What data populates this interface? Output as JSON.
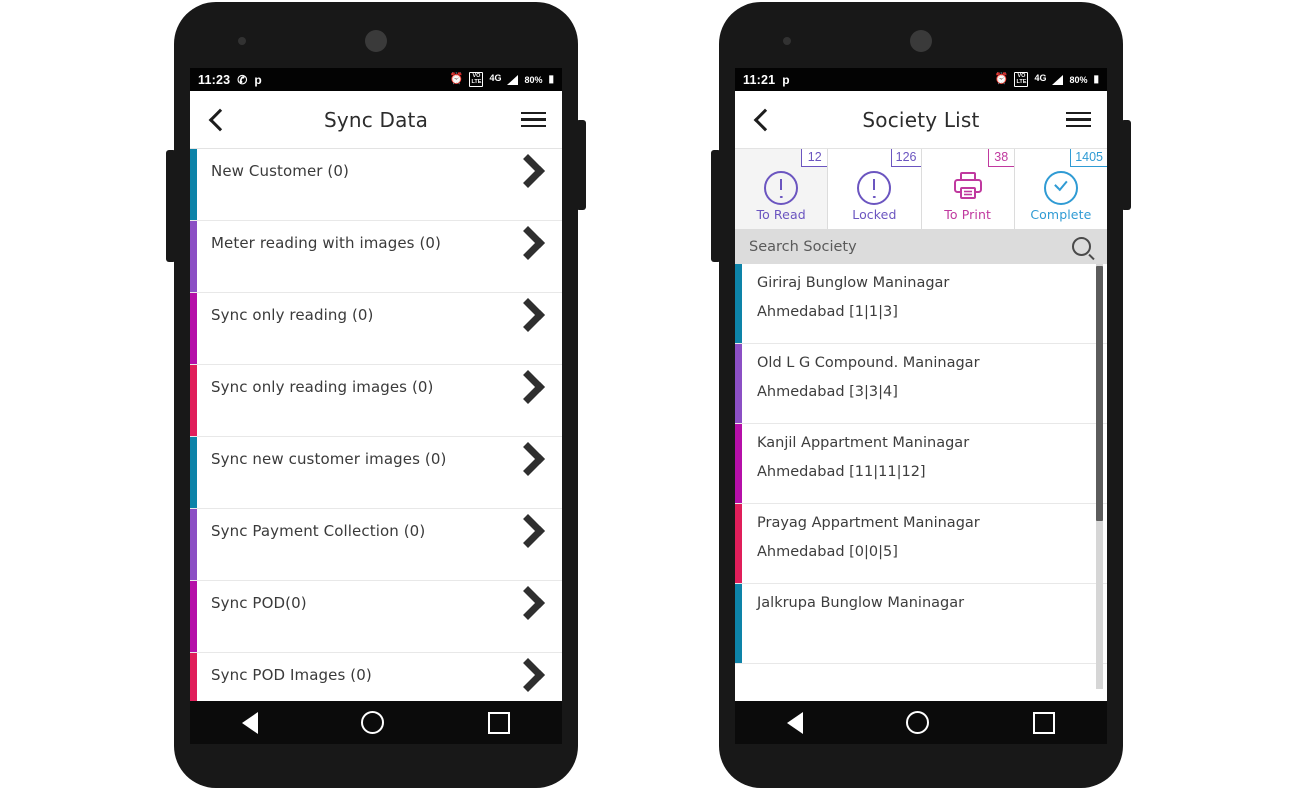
{
  "colors": {
    "teal": "#0d83a8",
    "purple": "#8b4fc4",
    "magenta": "#b50fa8",
    "crimson": "#e01e5a",
    "tab_purple": "#6b55c0",
    "tab_magenta": "#c0399f",
    "tab_blue": "#2f9bd4",
    "statusbar_bg": "#030303",
    "navbar_bg": "#0b0b0b",
    "search_bg": "#dcdcdc"
  },
  "left_phone": {
    "statusbar": {
      "time": "11:23",
      "icons_left": [
        "whatsapp-icon",
        "paytm-icon"
      ],
      "alarm": "alarm-icon",
      "volte": "VO LTE",
      "network": "4G",
      "signal": "signal-icon",
      "battery_percent": "80%",
      "battery": "battery-icon"
    },
    "appbar": {
      "back": "back-chevron-icon",
      "title": "Sync Data",
      "menu": "hamburger-menu-icon"
    },
    "rows": [
      {
        "label": "New Customer (0)",
        "accent": "#0d83a8"
      },
      {
        "label": "Meter reading with images (0)",
        "accent": "#8b4fc4"
      },
      {
        "label": "Sync only reading (0)",
        "accent": "#b50fa8"
      },
      {
        "label": "Sync only reading images (0)",
        "accent": "#e01e5a"
      },
      {
        "label": "Sync new customer images (0)",
        "accent": "#0d83a8"
      },
      {
        "label": "Sync Payment Collection (0)",
        "accent": "#8b4fc4"
      },
      {
        "label": "Sync POD(0)",
        "accent": "#b50fa8"
      },
      {
        "label": "Sync POD Images (0)",
        "accent": "#e01e5a"
      }
    ],
    "navbar": {
      "back": "nav-back-icon",
      "home": "nav-home-icon",
      "recents": "nav-recents-icon"
    }
  },
  "right_phone": {
    "statusbar": {
      "time": "11:21",
      "icons_left": [
        "paytm-icon"
      ],
      "alarm": "alarm-icon",
      "volte": "VO LTE",
      "network": "4G",
      "signal": "signal-icon",
      "battery_percent": "80%",
      "battery": "battery-icon"
    },
    "appbar": {
      "back": "back-chevron-icon",
      "title": "Society List",
      "menu": "hamburger-menu-icon"
    },
    "tabs": [
      {
        "label": "To Read",
        "count": "12",
        "color": "#6b55c0",
        "icon": "exclamation-circle-icon",
        "active": true
      },
      {
        "label": "Locked",
        "count": "126",
        "color": "#6b55c0",
        "icon": "exclamation-circle-icon",
        "active": false
      },
      {
        "label": "To Print",
        "count": "38",
        "color": "#c0399f",
        "icon": "printer-icon",
        "active": false
      },
      {
        "label": "Complete",
        "count": "1405",
        "color": "#2f9bd4",
        "icon": "check-circle-icon",
        "active": false
      }
    ],
    "search": {
      "placeholder": "Search Society",
      "value": "",
      "icon": "search-icon"
    },
    "societies": [
      {
        "name": "Giriraj Bunglow Maninagar",
        "sub": "Ahmedabad [1|1|3]",
        "accent": "#0d83a8"
      },
      {
        "name": "Old L G Compound. Maninagar",
        "sub": "Ahmedabad [3|3|4]",
        "accent": "#8b4fc4"
      },
      {
        "name": "Kanjil Appartment Maninagar",
        "sub": "Ahmedabad [11|11|12]",
        "accent": "#b50fa8"
      },
      {
        "name": "Prayag Appartment Maninagar",
        "sub": "Ahmedabad [0|0|5]",
        "accent": "#e01e5a"
      },
      {
        "name": "Jalkrupa Bunglow Maninagar",
        "sub": "",
        "accent": "#0d83a8"
      }
    ],
    "navbar": {
      "back": "nav-back-icon",
      "home": "nav-home-icon",
      "recents": "nav-recents-icon"
    }
  }
}
